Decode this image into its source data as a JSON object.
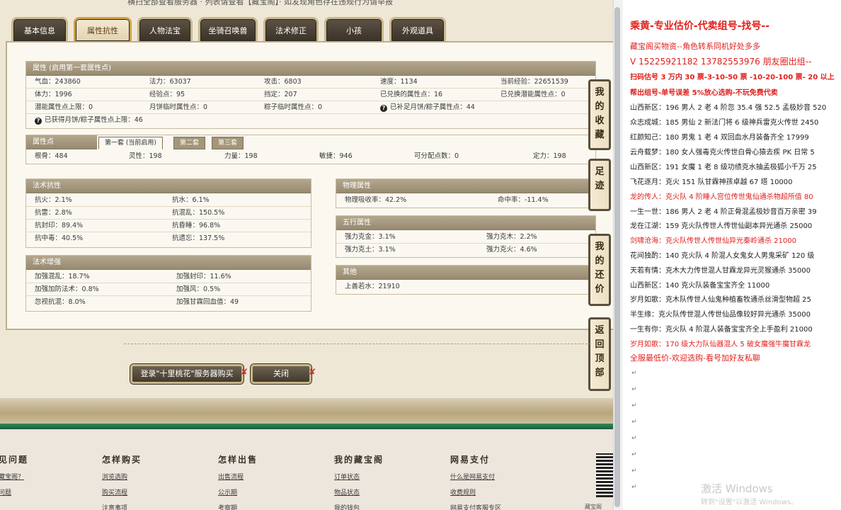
{
  "top_notice": "横扫全部查看服务器 · 列表请查看【藏宝阁】· 如发现角色存在违规行为请举报",
  "tabs": [
    "基本信息",
    "属性抗性",
    "人物法宝",
    "坐骑召唤兽",
    "法术修正",
    "小孩",
    "外观道具"
  ],
  "attr_section": {
    "title": "属性 (启用第一套属性点)",
    "rows": [
      [
        "气血：243860",
        "法力：63037",
        "攻击：6803",
        "速度：1134",
        "当前经验：22651539"
      ],
      [
        "体力：1996",
        "经验点：95",
        "挡定：207",
        "已兑换的属性点：16",
        "已兑换潜能属性点：0"
      ],
      [
        "潜能属性点上限：0",
        "月饼临时属性点：0",
        "粽子临时属性点：0",
        "已补足月饼/粽子属性点：44",
        ""
      ],
      [
        "已获得月饼/粽子属性点上限：46",
        "",
        "",
        "",
        ""
      ]
    ]
  },
  "points_section": {
    "title": "属性点",
    "subtabs": [
      "第一套 (当前启用)",
      "第二套",
      "第三套"
    ],
    "row": [
      "根骨：484",
      "灵性：198",
      "力量：198",
      "敏捷：946",
      "可分配点数：0",
      "定力：198"
    ]
  },
  "resist_section": {
    "title": "法术抗性",
    "rows": [
      [
        "抗火：2.1%",
        "抗水：6.1%"
      ],
      [
        "抗雷：2.8%",
        "抗混乱：150.5%"
      ],
      [
        "抗封印：89.4%",
        "抗昏睡：96.8%"
      ],
      [
        "抗中毒：40.5%",
        "抗遗忘：137.5%"
      ]
    ]
  },
  "enhance_section": {
    "title": "法术增强",
    "rows": [
      [
        "加强混乱：18.7%",
        "加强封印：11.6%"
      ],
      [
        "加强加防法术：0.8%",
        "加强风：0.5%"
      ],
      [
        "忽视抗混：8.0%",
        "加强甘霖回血值：49"
      ]
    ]
  },
  "physical_section": {
    "title": "物理属性",
    "row": [
      "物理吸收率：42.2%",
      "命中率：-11.4%"
    ]
  },
  "five_section": {
    "title": "五行属性",
    "rows": [
      [
        "强力克金：3.1%",
        "强力克木：2.2%"
      ],
      [
        "强力克土：3.1%",
        "强力克火：4.6%"
      ]
    ]
  },
  "other_section": {
    "title": "其他",
    "row": [
      "上善若水：21910"
    ]
  },
  "side_nav": [
    [
      "我",
      "的",
      "收",
      "藏"
    ],
    [
      "足",
      "迹"
    ],
    [
      "我",
      "的",
      "还",
      "价"
    ],
    [
      "返",
      "回",
      "顶",
      "部"
    ]
  ],
  "buttons": {
    "login": "登录\"十里桃花\"服务器购买",
    "close": "关闭"
  },
  "footer": {
    "columns": [
      {
        "head": "见问题",
        "links": [
          "藏宝阁？",
          "问题",
          ""
        ]
      },
      {
        "head": "怎样购买",
        "links": [
          "浏览选购",
          "购买流程",
          "注意事项"
        ]
      },
      {
        "head": "怎样出售",
        "links": [
          "出售流程",
          "公示期",
          "考察期"
        ]
      },
      {
        "head": "我的藏宝阁",
        "links": [
          "订单状态",
          "物品状态",
          "我的钱包"
        ]
      },
      {
        "head": "网易支付",
        "links": [
          "什么是网易支付",
          "收费规则",
          "网易支付客服专区"
        ]
      }
    ],
    "corner": "藏宝阁"
  },
  "doc": {
    "lines": [
      {
        "text": "乘黄-专业估价-代卖组号-找号--",
        "color": "red",
        "size": 14,
        "bold": true
      },
      {
        "text": "藏宝阁买物资--角色转系同机好处多多",
        "color": "red",
        "size": 11,
        "bold": false
      },
      {
        "text": "V 15225921182   13782553976 朋友圈出组--",
        "color": "red",
        "size": 12,
        "bold": false
      },
      {
        "text": "扫码估号 3 万内 30 票-3-10-50 票  -10-20-100 票- 20 以上",
        "color": "red",
        "size": 10,
        "bold": true
      },
      {
        "text": "帮出组号-单号误差 5%放心选购-不玩免费代卖",
        "color": "red",
        "size": 10,
        "bold": true
      },
      {
        "text": "山西新区：196 男人 2 老 4 阶忽 35.4 强 52.5 孟极妙音 520",
        "color": "black",
        "size": 10,
        "bold": false
      },
      {
        "text": "众志成城：185 男仙 2 新法门将 6 级神兵雷克火传世 2450",
        "color": "black",
        "size": 10,
        "bold": false
      },
      {
        "text": "红颜知己：180 男鬼 1 老 4 双回血水月装备齐全 17999",
        "color": "black",
        "size": 10,
        "bold": false
      },
      {
        "text": "云舟载梦：180 女人强毒克火传世白骨心猿去疾 PK 日常 5",
        "color": "black",
        "size": 10,
        "bold": false
      },
      {
        "text": "山西新区：191 女魔 1 老 8 级功绩克水抽孟极狐小千万 25",
        "color": "black",
        "size": 10,
        "bold": false
      },
      {
        "text": "飞花逐月：克火 151 队甘霖神孩卓越 67 塔 10000",
        "color": "black",
        "size": 10,
        "bold": false
      },
      {
        "text": "龙的传人：克火队 4 阶睡人宫位传世鬼仙通杀物超所值 80",
        "color": "red",
        "size": 10,
        "bold": false
      },
      {
        "text": "一生一世：186 男人 2 老 4 阶正骨混孟极妙音百万亲密 39",
        "color": "black",
        "size": 10,
        "bold": false
      },
      {
        "text": "龙在江湖：159 克火队传世人传世仙副本异光通杀 25000",
        "color": "black",
        "size": 10,
        "bold": false
      },
      {
        "text": "剑啸沧海：克火队传世人传世仙异光秦岭通杀 21000",
        "color": "red",
        "size": 10,
        "bold": false
      },
      {
        "text": "花间独酌：140 克火队 4 阶混人女鬼女人男鬼采矿 120 级",
        "color": "black",
        "size": 10,
        "bold": false
      },
      {
        "text": "天若有情：克木大力传世混人甘霖龙异光灵猴通杀 35000",
        "color": "black",
        "size": 10,
        "bold": false
      },
      {
        "text": "山西新区：140 克火队装备宝宝齐全 11000",
        "color": "black",
        "size": 10,
        "bold": false
      },
      {
        "text": "岁月如歌：克木队传世人仙鬼种植畜牧通杀丝滑型物超 25",
        "color": "black",
        "size": 10,
        "bold": false
      },
      {
        "text": "半生缘：克火队传世混人传世仙品像较好异光通杀 35000",
        "color": "black",
        "size": 10,
        "bold": false
      },
      {
        "text": "一生有你：克火队 4 阶混人装备宝宝齐全上手盈利 21000",
        "color": "black",
        "size": 10,
        "bold": false
      },
      {
        "text": "岁月如歌：170 级大力队仙器混人 5 破女魔强牛魔甘霖龙",
        "color": "red",
        "size": 10,
        "bold": false
      },
      {
        "text": "全服最低价-欢迎选购-看号加好友私聊",
        "color": "red",
        "size": 11,
        "bold": false
      }
    ],
    "watermark_title": "激活 Windows",
    "watermark_sub": "转到\"设置\"以激活 Windows。"
  },
  "colors": {
    "accent_red": "#e0201c",
    "tab_dark": "#4b4236",
    "section_header": "#a89b80"
  }
}
